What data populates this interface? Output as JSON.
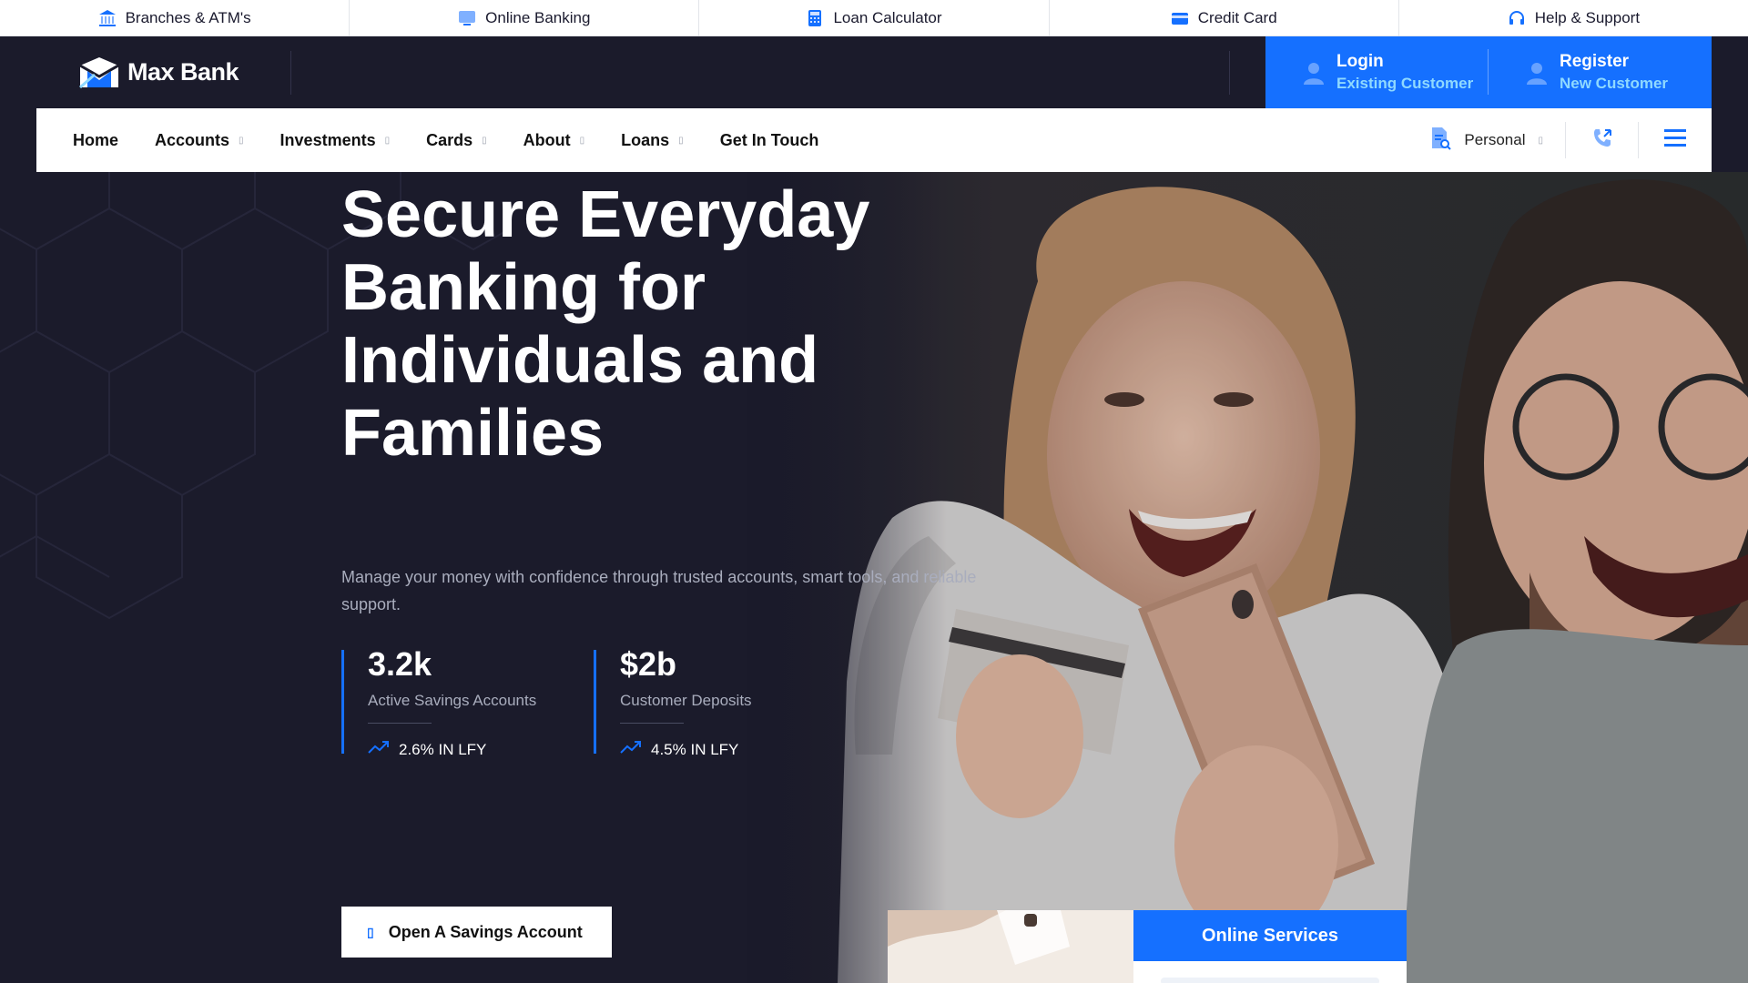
{
  "topbar": {
    "items": [
      {
        "label": "Branches & ATM's",
        "icon": "bank-icon"
      },
      {
        "label": "Online Banking",
        "icon": "monitor-icon"
      },
      {
        "label": "Loan Calculator",
        "icon": "calculator-icon"
      },
      {
        "label": "Credit Card",
        "icon": "credit-card-icon"
      },
      {
        "label": "Help & Support",
        "icon": "headset-icon"
      }
    ]
  },
  "header": {
    "logo_text": "Max Bank",
    "login": {
      "title": "Login",
      "subtitle": "Existing Customer"
    },
    "register": {
      "title": "Register",
      "subtitle": "New Customer"
    }
  },
  "nav": {
    "items": [
      {
        "label": "Home",
        "dropdown": false
      },
      {
        "label": "Accounts",
        "dropdown": true
      },
      {
        "label": "Investments",
        "dropdown": true
      },
      {
        "label": "Cards",
        "dropdown": true
      },
      {
        "label": "About",
        "dropdown": true
      },
      {
        "label": "Loans",
        "dropdown": true
      },
      {
        "label": "Get In Touch",
        "dropdown": false
      }
    ],
    "personal_label": "Personal"
  },
  "hero": {
    "title": "Secure Everyday Banking for Individuals and Families",
    "description": "Manage your money with confidence through trusted accounts, smart tools, and reliable support.",
    "stats": [
      {
        "value": "3.2k",
        "label": "Active Savings Accounts",
        "trend": "2.6% IN LFY"
      },
      {
        "value": "$2b",
        "label": "Customer Deposits",
        "trend": "4.5% IN LFY"
      }
    ],
    "cta_label": "Open A Savings Account",
    "services_title": "Online Services"
  },
  "colors": {
    "accent": "#1570ff",
    "dark": "#1b1b2b",
    "muted_text": "#a9adbd",
    "auth_subtitle": "#8fd9ff"
  }
}
